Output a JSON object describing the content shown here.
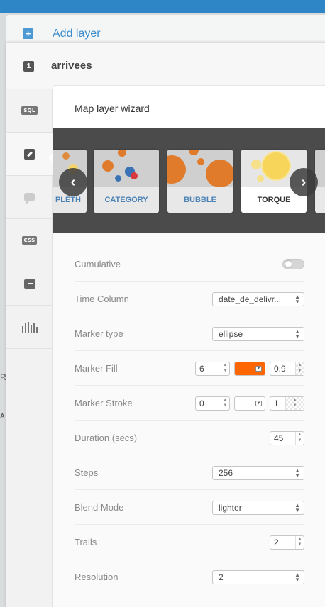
{
  "add_layer": {
    "label": "Add layer",
    "icon": "plus-icon"
  },
  "layer": {
    "index": "1",
    "name": "arrivees"
  },
  "toolbar": {
    "sql_label": "SQL",
    "css_label": "CSS",
    "items": [
      "sql-icon",
      "brush-icon",
      "infowindow-icon",
      "css-icon",
      "legend-icon",
      "histogram-icon"
    ]
  },
  "wizard": {
    "title": "Map layer wizard",
    "cards": [
      {
        "label": "PLETH",
        "selected": false
      },
      {
        "label": "CATEGORY",
        "selected": false
      },
      {
        "label": "BUBBLE",
        "selected": false
      },
      {
        "label": "TORQUE",
        "selected": true
      }
    ]
  },
  "props": {
    "cumulative": {
      "label": "Cumulative",
      "enabled": false
    },
    "time_column": {
      "label": "Time Column",
      "value": "date_de_delivr..."
    },
    "marker_type": {
      "label": "Marker type",
      "value": "ellipse"
    },
    "marker_fill": {
      "label": "Marker Fill",
      "width": "6",
      "color": "#ff6600",
      "opacity": "0.9"
    },
    "marker_stroke": {
      "label": "Marker Stroke",
      "width": "0",
      "color": "#ffffff",
      "opacity": "1"
    },
    "duration": {
      "label": "Duration (secs)",
      "value": "45"
    },
    "steps": {
      "label": "Steps",
      "value": "256"
    },
    "blend_mode": {
      "label": "Blend Mode",
      "value": "lighter"
    },
    "trails": {
      "label": "Trails",
      "value": "2"
    },
    "resolution": {
      "label": "Resolution",
      "value": "2"
    }
  },
  "map_edge": {
    "letter_1": "R",
    "letter_2": "A"
  },
  "colors": {
    "accent": "#3b8ccb",
    "topbar": "#2f86c6",
    "fill_orange": "#ff6600"
  }
}
